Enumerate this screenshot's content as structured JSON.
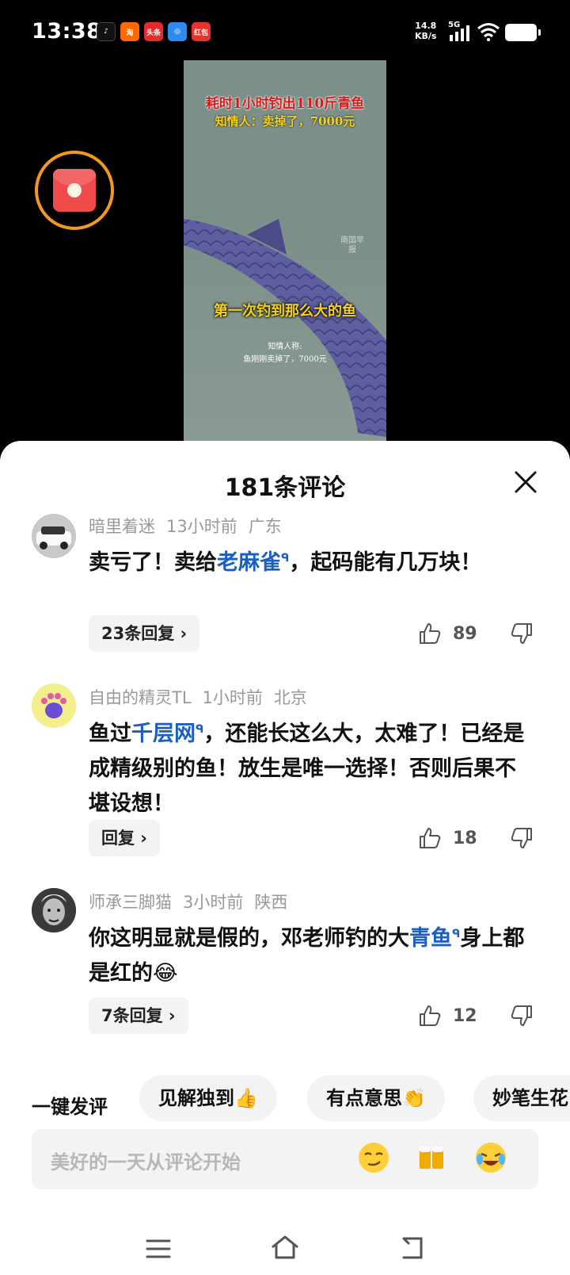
{
  "status_bar": {
    "time": "13:38",
    "net_speed_value": "14.8",
    "net_speed_unit": "KB/s",
    "network": "5G",
    "app_icons": [
      "douyin-icon",
      "taobao-icon",
      "toutiao-icon",
      "browser-icon",
      "hongbao-app-icon"
    ],
    "app_icon_labels": [
      "",
      "",
      "头条",
      "",
      "红包"
    ]
  },
  "video": {
    "headline": "耗时1小时钓出110斤青鱼",
    "subheadline": "知情人：卖掉了，7000元",
    "watermark": "南国早报",
    "caption": "第一次钓到那么大的鱼",
    "sub_line1": "知情人称:",
    "sub_line2": "鱼刚刚卖掉了，7000元"
  },
  "sheet": {
    "title": "181条评论"
  },
  "comments": [
    {
      "user": "暗里着迷",
      "time": "13小时前",
      "location": "广东",
      "text_before": "卖亏了！卖给",
      "link": "老麻雀",
      "text_after": "，起码能有几万块！",
      "reply_label": "23条回复 ›",
      "likes": "89"
    },
    {
      "user": "自由的精灵TL",
      "time": "1小时前",
      "location": "北京",
      "text_before": "鱼过",
      "link": "千层网",
      "text_after": "，还能长这么大，太难了！已经是成精级别的鱼！放生是唯一选择！否则后果不堪设想！",
      "reply_label": "回复 ›",
      "likes": "18"
    },
    {
      "user": "师承三脚猫",
      "time": "3小时前",
      "location": "陕西",
      "text_before": "你这明显就是假的，邓老师钓的大",
      "link": "青鱼",
      "text_after": "身上都是红的😂",
      "reply_label": "7条回复 ›",
      "likes": "12"
    }
  ],
  "quick_reply": {
    "label": "一键发评",
    "chips": [
      "见解独到👍",
      "有点意思👏",
      "妙笔生花"
    ]
  },
  "input": {
    "placeholder": "美好的一天从评论开始",
    "emojis": [
      "smirk-emoji",
      "beer-emoji",
      "crying-laugh-emoji"
    ]
  },
  "colors": {
    "link_blue": "#1b5fc0",
    "envelope_ring": "#f39a1e",
    "envelope_red": "#ef4b4b"
  }
}
